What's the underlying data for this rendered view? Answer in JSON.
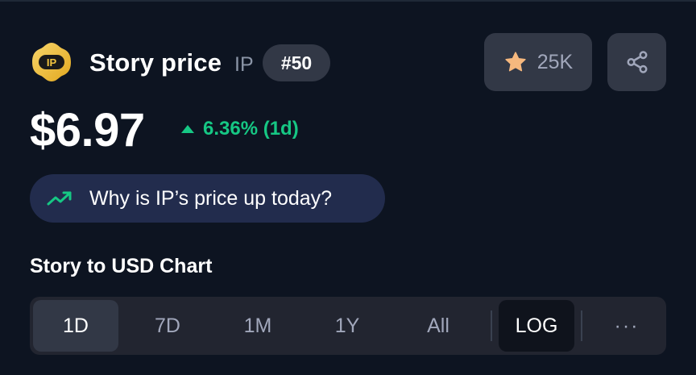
{
  "coin": {
    "logo_text": "IP",
    "name": "Story price",
    "symbol": "IP",
    "rank": "#50"
  },
  "watchlist": {
    "count": "25K",
    "icon": "star-icon"
  },
  "share": {
    "icon": "share-icon"
  },
  "price": {
    "value": "$6.97",
    "change": "6.36% (1d)",
    "direction": "up",
    "change_color": "#16c784"
  },
  "why_pill": {
    "text": "Why is IP’s price up today?",
    "icon": "trending-up-icon"
  },
  "chart": {
    "title": "Story to USD Chart",
    "ranges": [
      "1D",
      "7D",
      "1M",
      "1Y",
      "All"
    ],
    "active_range": "1D",
    "log_label": "LOG",
    "more_label": "···"
  },
  "colors": {
    "background": "#0d1421",
    "positive": "#16c784",
    "star": "#f6b87e",
    "logo_gold": "#f3c53f"
  }
}
